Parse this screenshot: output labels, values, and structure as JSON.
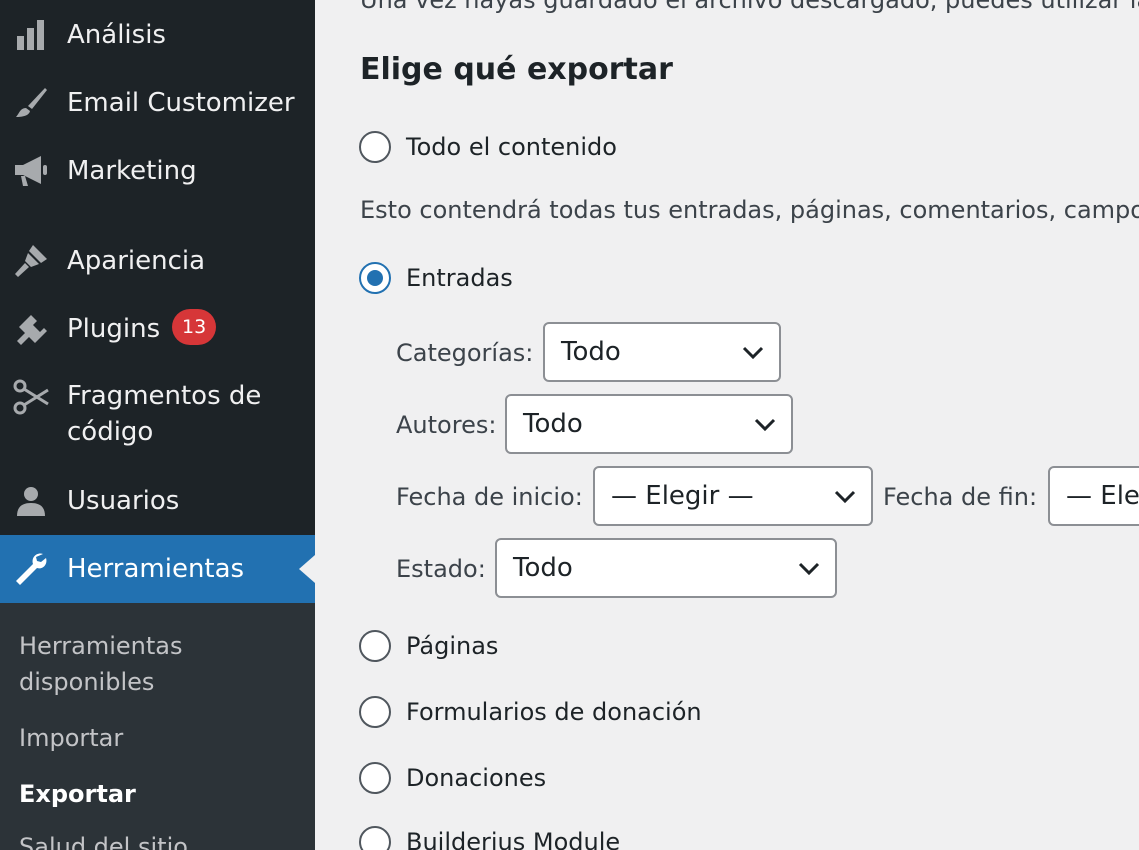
{
  "sidebar": {
    "items": [
      {
        "label": "Análisis",
        "icon": "chart-bar-icon"
      },
      {
        "label": "Email Customizer",
        "icon": "paintbrush-icon"
      },
      {
        "label": "Marketing",
        "icon": "megaphone-icon"
      },
      {
        "label": "Apariencia",
        "icon": "brush-icon"
      },
      {
        "label": "Plugins",
        "icon": "plugin-icon",
        "badge": "13"
      },
      {
        "label_line1": "Fragmentos de",
        "label_line2": "código",
        "icon": "scissors-icon"
      },
      {
        "label": "Usuarios",
        "icon": "user-icon"
      },
      {
        "label": "Herramientas",
        "icon": "wrench-icon",
        "active": true
      }
    ],
    "submenu": {
      "item1_line1": "Herramientas",
      "item1_line2": "disponibles",
      "item2": "Importar",
      "item3": "Exportar",
      "item4": "Salud del sitio"
    },
    "colors": {
      "bg": "#1d2327",
      "active": "#2271b1",
      "badge": "#d63638",
      "submenu_bg": "#2c3338"
    }
  },
  "main": {
    "top_text": "Una vez hayas guardado el archivo descargado, puedes utilizar la",
    "heading": "Elige qué exportar",
    "options": {
      "all": "Todo el contenido",
      "all_desc": "Esto contendrá todas tus entradas, páginas, comentarios, campos",
      "posts": "Entradas",
      "pages": "Páginas",
      "donation_forms": "Formularios de donación",
      "donations": "Donaciones",
      "builderius": "Builderius Module"
    },
    "selected_option": "Entradas",
    "filters": {
      "categories_label": "Categorías:",
      "categories_value": "Todo",
      "authors_label": "Autores:",
      "authors_value": "Todo",
      "start_date_label": "Fecha de inicio:",
      "start_date_value": "— Elegir —",
      "end_date_label": "Fecha de fin:",
      "end_date_value": "— Elegir —",
      "status_label": "Estado:",
      "status_value": "Todo"
    },
    "accent_color": "#2271b1"
  }
}
